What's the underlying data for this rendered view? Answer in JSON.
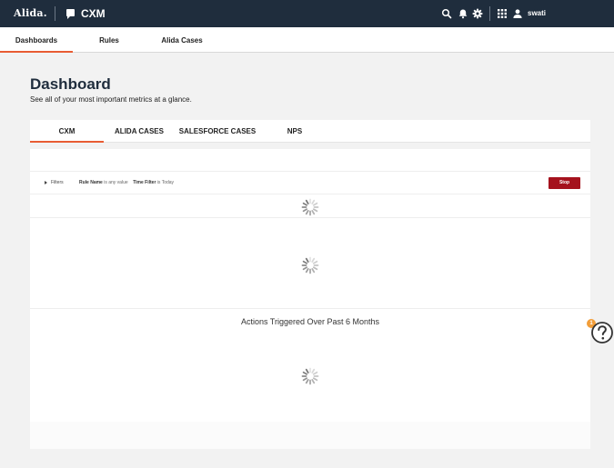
{
  "header": {
    "logo": "Alida.",
    "app_name": "CXM",
    "username": "swati",
    "icons": [
      "chat-icon",
      "search-icon",
      "bell-icon",
      "gear-icon",
      "apps-grid-icon",
      "user-icon"
    ]
  },
  "nav": {
    "tabs": [
      {
        "label": "Dashboards",
        "active": true
      },
      {
        "label": "Rules",
        "active": false
      },
      {
        "label": "Alida Cases",
        "active": false
      }
    ]
  },
  "page": {
    "title": "Dashboard",
    "subtitle": "See all of your most important metrics at a glance."
  },
  "panel_tabs": [
    {
      "label": "CXM",
      "active": true
    },
    {
      "label": "ALIDA CASES",
      "active": false
    },
    {
      "label": "SALESFORCE CASES",
      "active": false
    },
    {
      "label": "NPS",
      "active": false
    }
  ],
  "filters": {
    "toggle_label": "Filters",
    "rule_label": "Rule Name",
    "rule_value": "is any value",
    "time_label": "Time Filter",
    "time_value": "is Today",
    "stop_label": "Stop"
  },
  "widgets": {
    "actions_title": "Actions Triggered Over Past 6 Months"
  },
  "help": {
    "badge_count": "1",
    "icon": "help-question-icon"
  },
  "colors": {
    "topbar": "#1f2d3d",
    "accent": "#e85c33",
    "stop_button": "#a5121d",
    "badge": "#f29d38"
  }
}
